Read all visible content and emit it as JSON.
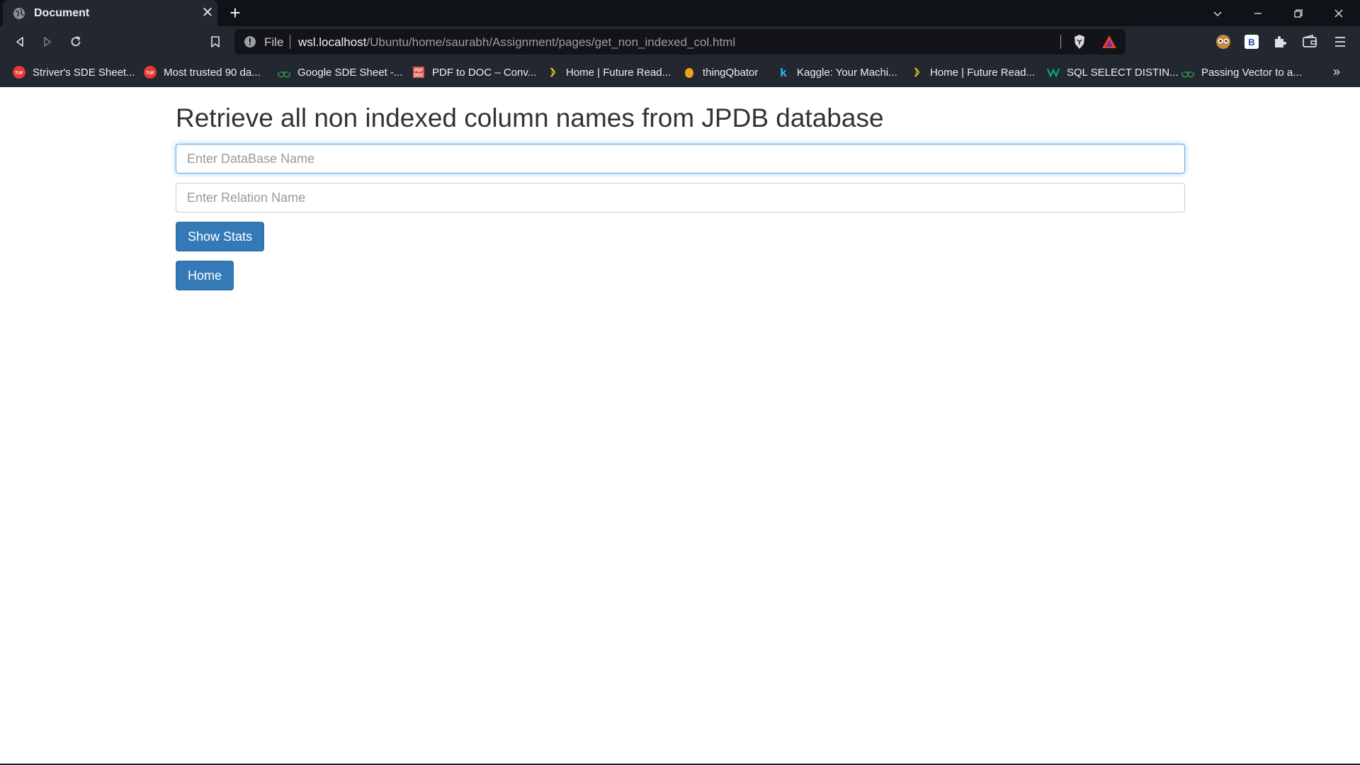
{
  "browser": {
    "tab": {
      "title": "Document",
      "close": "✕"
    },
    "new_tab": "+",
    "address": {
      "scheme_label": "File",
      "host": "wsl.localhost",
      "path": "/Ubuntu/home/saurabh/Assignment/pages/get_non_indexed_col.html"
    },
    "bookmarks": [
      {
        "label": "Striver's SDE Sheet...",
        "icon": "tuf-icon",
        "color": "#e53935"
      },
      {
        "label": "Most trusted 90 da...",
        "icon": "tuf-icon",
        "color": "#e53935"
      },
      {
        "label": "Google SDE Sheet -...",
        "icon": "gfg-icon",
        "color": "#2f8d46"
      },
      {
        "label": "PDF to DOC – Conv...",
        "icon": "pdf2doc-icon",
        "color": "#d9534f"
      },
      {
        "label": "Home | Future Read...",
        "icon": "future-ready-icon",
        "color": "#f5c518"
      },
      {
        "label": "thingQbator",
        "icon": "thingqbator-icon",
        "color": "#f0a020"
      },
      {
        "label": "Kaggle: Your Machi...",
        "icon": "kaggle-icon",
        "color": "#20beff"
      },
      {
        "label": "Home | Future Read...",
        "icon": "future-ready-icon",
        "color": "#f5c518"
      },
      {
        "label": "SQL SELECT DISTIN...",
        "icon": "w3schools-icon",
        "color": "#04aa6d"
      },
      {
        "label": "Passing Vector to a...",
        "icon": "gfg-icon",
        "color": "#2f8d46"
      }
    ],
    "bookmarks_more": "»"
  },
  "page": {
    "title": "Retrieve all non indexed column names from JPDB database",
    "database_input": {
      "placeholder": "Enter DataBase Name",
      "value": ""
    },
    "relation_input": {
      "placeholder": "Enter Relation Name",
      "value": ""
    },
    "show_stats_label": "Show Stats",
    "home_label": "Home"
  },
  "colors": {
    "primary_button": "#337ab7",
    "title_text": "#333333",
    "focus_border": "#66afe9",
    "chrome_dark": "#0f1216",
    "chrome_toolbar": "#232730"
  }
}
